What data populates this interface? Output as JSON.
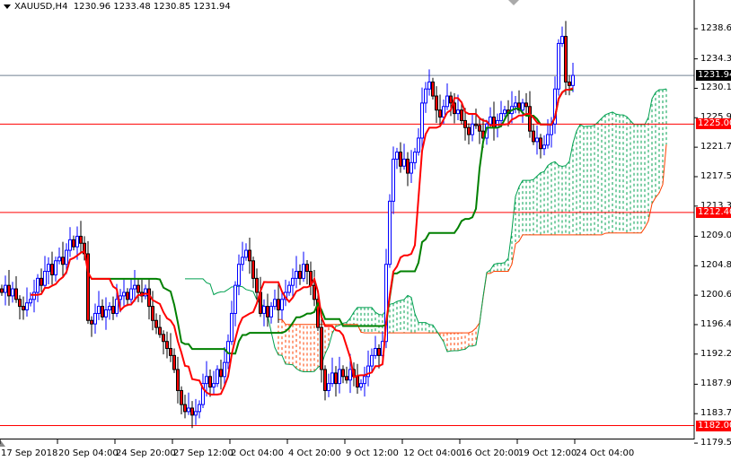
{
  "header": {
    "symbol": "XAUUSD,H4",
    "ohlc": "1230.96 1233.48 1230.85 1231.94"
  },
  "colors": {
    "bull": "#0000ff",
    "bear": "#ff0000",
    "tenkan": "#ff0000",
    "kijun": "#008000",
    "cloud_up": "#00a050",
    "cloud_down": "#ff4000",
    "level": "#ff0000",
    "current": "#708090"
  },
  "chart_data": {
    "type": "candlestick",
    "title": "XAUUSD,H4",
    "ylim": [
      1179.5,
      1238.6
    ],
    "y_ticks": [
      "1238.60",
      "1234.30",
      "1230.10",
      "1225.90",
      "1221.70",
      "1217.50",
      "1213.30",
      "1209.00",
      "1204.80",
      "1200.60",
      "1196.40",
      "1192.20",
      "1187.90",
      "1183.70",
      "1179.50"
    ],
    "x_ticks": [
      {
        "bar": 0,
        "label": "17 Sep 2018"
      },
      {
        "bar": 16,
        "label": "20 Sep 04:00"
      },
      {
        "bar": 32,
        "label": "24 Sep 20:00"
      },
      {
        "bar": 48,
        "label": "27 Sep 12:00"
      },
      {
        "bar": 64,
        "label": "2 Oct 04:00"
      },
      {
        "bar": 80,
        "label": "4 Oct 20:00"
      },
      {
        "bar": 96,
        "label": "9 Oct 12:00"
      },
      {
        "bar": 112,
        "label": "12 Oct 04:00"
      },
      {
        "bar": 128,
        "label": "16 Oct 20:00"
      },
      {
        "bar": 144,
        "label": "19 Oct 12:00"
      },
      {
        "bar": 160,
        "label": "24 Oct 04:00"
      }
    ],
    "close": [
      1201,
      1202,
      1200.5,
      1201.5,
      1200,
      1199,
      1198.5,
      1199.5,
      1200,
      1201,
      1203,
      1202,
      1204,
      1205,
      1203.5,
      1205.5,
      1206,
      1205,
      1207,
      1208.5,
      1207.5,
      1209,
      1208,
      1206.5,
      1197,
      1196.5,
      1198,
      1199,
      1197.5,
      1198.5,
      1199,
      1198,
      1200,
      1200.5,
      1201,
      1200,
      1201.5,
      1202,
      1201,
      1200.5,
      1201.5,
      1199,
      1197,
      1196,
      1195,
      1194,
      1193,
      1192,
      1190,
      1187,
      1185,
      1184,
      1184.5,
      1183.5,
      1184,
      1185,
      1188,
      1189,
      1187.5,
      1188,
      1190,
      1189,
      1191,
      1194,
      1198,
      1202,
      1205,
      1206,
      1207,
      1205.5,
      1203,
      1201,
      1198,
      1199,
      1197.5,
      1199,
      1200,
      1198.5,
      1200,
      1201,
      1202,
      1203,
      1204,
      1203,
      1205,
      1204,
      1202,
      1200,
      1196,
      1190,
      1187,
      1188,
      1189.5,
      1188,
      1190,
      1189,
      1188.5,
      1190,
      1189,
      1187.5,
      1188,
      1189,
      1190.5,
      1192,
      1193,
      1192,
      1194,
      1205,
      1214,
      1220,
      1221,
      1219,
      1220,
      1218,
      1219.5,
      1221,
      1223,
      1228,
      1230,
      1231,
      1229,
      1227,
      1226,
      1227.5,
      1229,
      1228,
      1226.5,
      1227,
      1225.5,
      1224.5,
      1223.5,
      1225,
      1224.8,
      1224,
      1223,
      1225,
      1226,
      1224.5,
      1225.5,
      1226.5,
      1227,
      1226.5,
      1227.5,
      1228,
      1227,
      1228,
      1227.5,
      1224,
      1222.5,
      1223,
      1221.5,
      1222,
      1223.5,
      1225,
      1230,
      1236.5,
      1237.5,
      1231,
      1230.5,
      1231.94
    ],
    "indicators": [
      "Ichimoku Tenkan-sen (9)",
      "Kijun-sen (26)",
      "Senkou Span A/B (52, shift 26)"
    ],
    "levels": [
      {
        "price": 1231.94,
        "label": "1231.94",
        "kind": "current"
      },
      {
        "price": 1225.0,
        "label": "1225.00",
        "kind": "level"
      },
      {
        "price": 1212.4,
        "label": "1212.40",
        "kind": "level"
      },
      {
        "price": 1182.0,
        "label": "1182.00",
        "kind": "level"
      }
    ]
  }
}
